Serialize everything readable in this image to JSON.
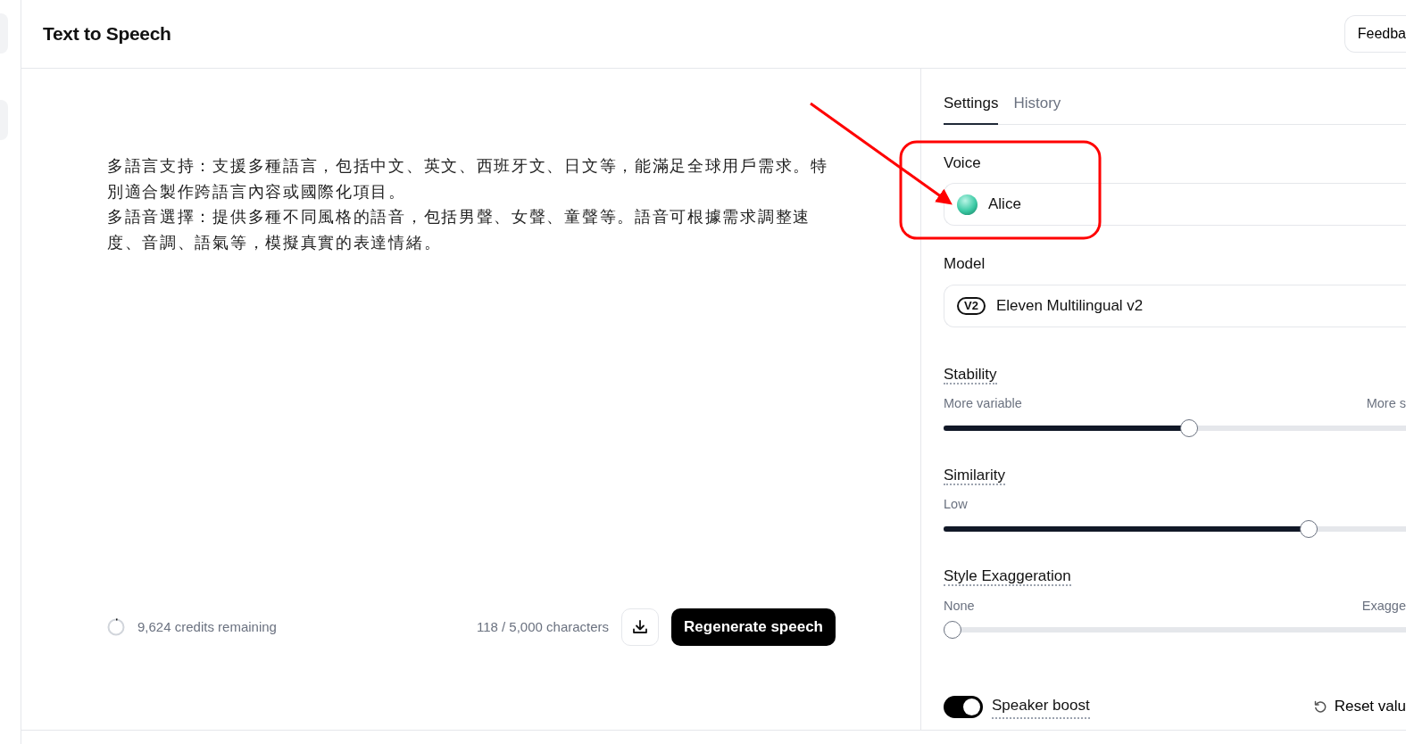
{
  "header": {
    "title": "Text to Speech",
    "feedback_button": "Feedba"
  },
  "editor": {
    "paragraphs": [
      "多語言支持：支援多種語言，包括中文、英文、西班牙文、日文等，能滿足全球用戶需求。特別適合製作跨語言內容或國際化項目。",
      "多語音選擇：提供多種不同風格的語音，包括男聲、女聲、童聲等。語音可根據需求調整速度、音調、語氣等，模擬真實的表達情緒。"
    ]
  },
  "footer": {
    "credits": "9,624 credits remaining",
    "characters": "118 / 5,000 characters",
    "regenerate_button": "Regenerate speech"
  },
  "tabs": [
    {
      "label": "Settings",
      "selected": true
    },
    {
      "label": "History",
      "selected": false
    }
  ],
  "voice": {
    "label": "Voice",
    "value": "Alice"
  },
  "model": {
    "label": "Model",
    "badge": "V2",
    "value": "Eleven Multilingual v2"
  },
  "sliders": [
    {
      "label": "Stability",
      "left": "More variable",
      "right": "More s",
      "level": 0.53
    },
    {
      "label": "Similarity",
      "left": "Low",
      "level": 0.79
    },
    {
      "label": "Style Exaggeration",
      "left": "None",
      "right": "Exagge",
      "level": 0
    }
  ],
  "speaker_boost": {
    "label": "Speaker boost",
    "on": true
  },
  "reset_button": "Reset valu"
}
